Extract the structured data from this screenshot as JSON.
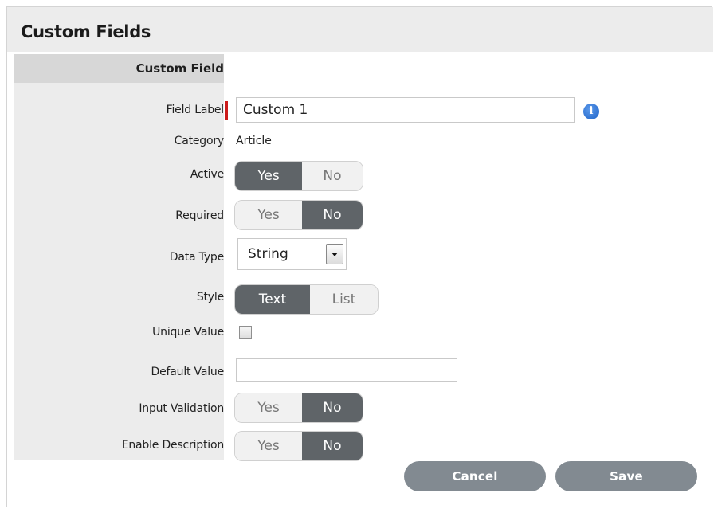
{
  "panel": {
    "title": "Custom Fields"
  },
  "form": {
    "section_header": "Custom Field",
    "field_label": {
      "label": "Field Label",
      "value": "Custom 1",
      "required": true,
      "info_icon": "info-icon"
    },
    "category": {
      "label": "Category",
      "value": "Article"
    },
    "active": {
      "label": "Active",
      "options": [
        "Yes",
        "No"
      ],
      "selected": "Yes"
    },
    "required": {
      "label": "Required",
      "options": [
        "Yes",
        "No"
      ],
      "selected": "No"
    },
    "data_type": {
      "label": "Data Type",
      "value": "String"
    },
    "style": {
      "label": "Style",
      "options": [
        "Text",
        "List"
      ],
      "selected": "Text"
    },
    "unique_value": {
      "label": "Unique Value",
      "checked": false
    },
    "default_value": {
      "label": "Default Value",
      "value": ""
    },
    "input_validation": {
      "label": "Input Validation",
      "options": [
        "Yes",
        "No"
      ],
      "selected": "No"
    },
    "enable_description": {
      "label": "Enable Description",
      "options": [
        "Yes",
        "No"
      ],
      "selected": "No"
    }
  },
  "buttons": {
    "cancel": "Cancel",
    "save": "Save"
  },
  "colors": {
    "toggle_on": "#5f6468",
    "toggle_off": "#f1f1f1",
    "required_marker": "#cc1b1b",
    "button": "#828a91",
    "info_icon": "#1f64c8"
  }
}
